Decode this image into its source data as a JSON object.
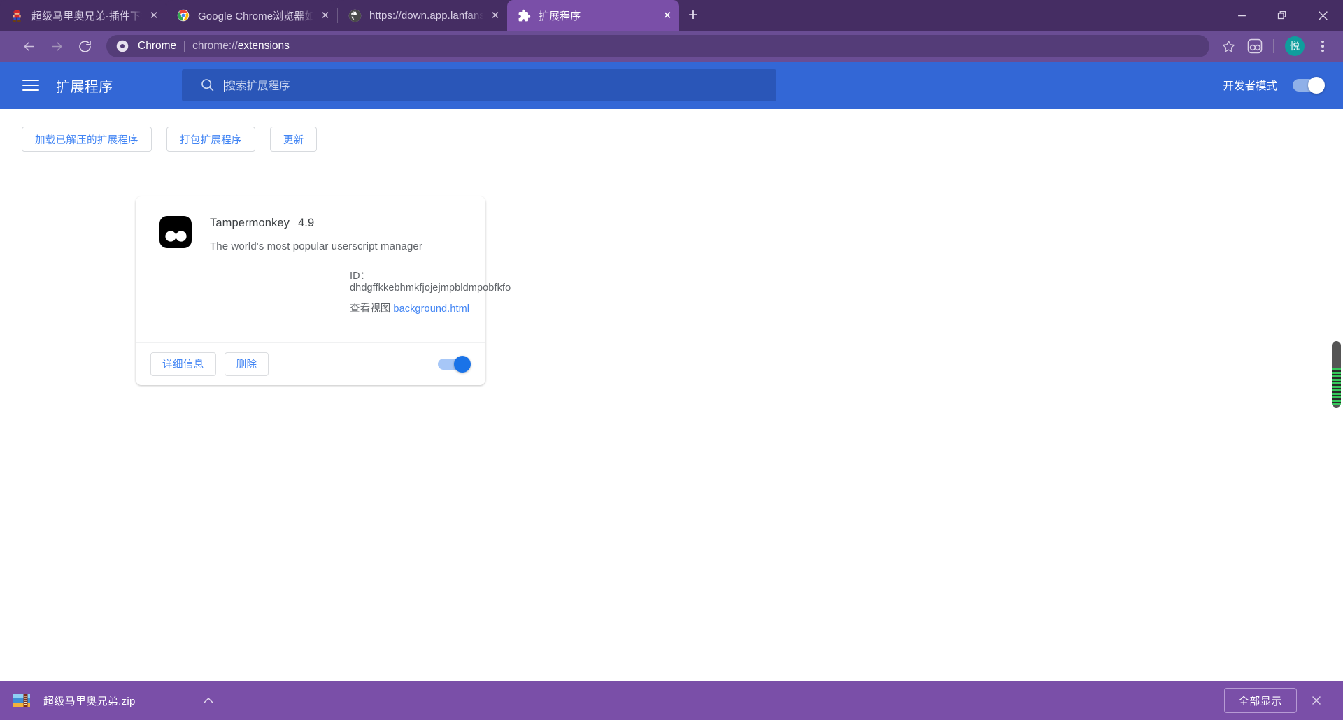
{
  "window": {
    "minimize_label": "minimize",
    "maximize_label": "maximize",
    "close_label": "close"
  },
  "tabs": [
    {
      "title": "超级马里奥兄弟-插件下载-Chrom",
      "favicon": "mario-icon",
      "active": false,
      "close_label": "✕"
    },
    {
      "title": "Google Chrome浏览器如何安装",
      "favicon": "chrome-icon",
      "active": false,
      "close_label": "✕"
    },
    {
      "title": "https://down.app.lanfanshu.cn",
      "favicon": "globe-icon",
      "active": false,
      "close_label": "✕"
    },
    {
      "title": "扩展程序",
      "favicon": "puzzle-icon",
      "active": true,
      "close_label": "✕"
    }
  ],
  "newtab_label": "+",
  "toolbar": {
    "back_label": "后退",
    "forward_label": "前进",
    "reload_label": "重新加载",
    "omnibox": {
      "chip": "Chrome",
      "scheme": "chrome://",
      "path": "extensions"
    },
    "bookmark_label": "收藏",
    "extension_icon_label": "Tampermonkey",
    "avatar_initial": "悦",
    "menu_label": "更多"
  },
  "extensions_page": {
    "menu_label": "主菜单",
    "title": "扩展程序",
    "search": {
      "placeholder": "搜索扩展程序",
      "value": ""
    },
    "dev_mode_label": "开发者模式",
    "dev_mode_on": true,
    "actions": [
      {
        "label": "加载已解压的扩展程序"
      },
      {
        "label": "打包扩展程序"
      },
      {
        "label": "更新"
      }
    ],
    "cards": [
      {
        "name": "Tampermonkey",
        "version": "4.9",
        "description": "The world's most popular userscript manager",
        "id_label": "ID：",
        "id_value": "dhdgffkkebhmkfjojejmpbldmpobfkfo",
        "views_label": "查看视图",
        "view_link": "background.html",
        "details_label": "详细信息",
        "remove_label": "删除",
        "enabled": true
      }
    ]
  },
  "download_shelf": {
    "file_name": "超级马里奥兄弟.zip",
    "menu_label": "∧",
    "show_all_label": "全部显示",
    "close_label": "✕"
  },
  "colors": {
    "tabstrip_bg": "#452d63",
    "tab_active_bg": "#7a4fa8",
    "toolbar_bg": "#6a4d94",
    "omnibox_bg": "#543c78",
    "ext_header_bg": "#3367d6",
    "search_bg": "#2a56b8",
    "accent_blue": "#4285f4",
    "toggle_on": "#1a73e8",
    "shelf_bg": "#7a4fa8",
    "avatar_bg": "#0f9d9d",
    "scrollbar_green": "#35c75a"
  }
}
